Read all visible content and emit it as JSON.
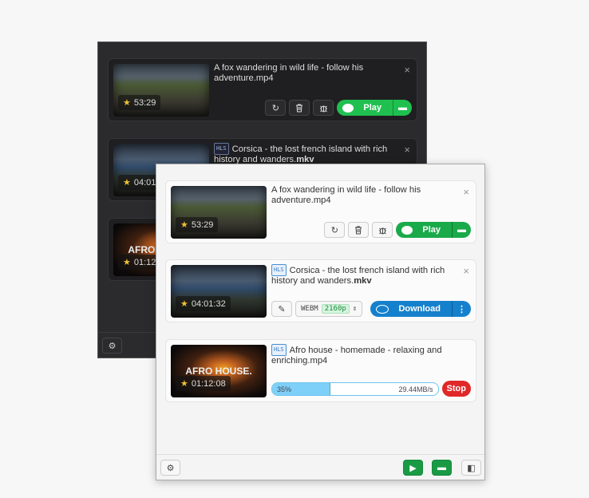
{
  "dark_window": {
    "items": [
      {
        "thumb": "fox",
        "duration": "53:29",
        "hls": false,
        "title": "A fox wandering in wild life - follow his adventure.mp4",
        "ext": "",
        "mode": "done",
        "play_label": "Play"
      },
      {
        "thumb": "sea",
        "duration": "04:01:32",
        "hls": true,
        "hls_label": "HLS",
        "title": "Corsica - the lost french island with rich history and wanders.",
        "ext": "mkv",
        "mode": "hidden"
      },
      {
        "thumb": "sun",
        "overlay": "AFRO HOUSE.",
        "duration": "01:12:08",
        "hls": true,
        "hls_label": "HLS",
        "title": "",
        "ext": "",
        "mode": "hidden"
      }
    ]
  },
  "light_window": {
    "items": [
      {
        "thumb": "fox",
        "duration": "53:29",
        "hls": false,
        "title": "A fox wandering in wild life - follow his adventure.mp4",
        "ext": "",
        "mode": "done",
        "play_label": "Play"
      },
      {
        "thumb": "sea",
        "duration": "04:01:32",
        "hls": true,
        "hls_label": "HLS",
        "title": "Corsica - the lost french island with rich history and wanders.",
        "ext": "mkv",
        "mode": "ready",
        "format": "WEBM",
        "quality": "2160p",
        "download_label": "Download"
      },
      {
        "thumb": "sun",
        "overlay": "AFRO HOUSE.",
        "duration": "01:12:08",
        "hls": true,
        "hls_label": "HLS",
        "title": "Afro house - homemade - relaxing and enriching.mp4",
        "ext": "",
        "mode": "progress",
        "progress_percent": 35,
        "progress_label": "35%",
        "speed": "29.44MB/s",
        "stop_label": "Stop"
      }
    ]
  },
  "icons": {
    "close": "×",
    "refresh": "↻",
    "trash": "🗑",
    "bug": "bug-icon",
    "star": "★",
    "settings": "⚙"
  },
  "colors": {
    "play": "#1aaa4a",
    "download": "#1581cc",
    "stop": "#e02828",
    "progress": "#7fd0f8"
  }
}
